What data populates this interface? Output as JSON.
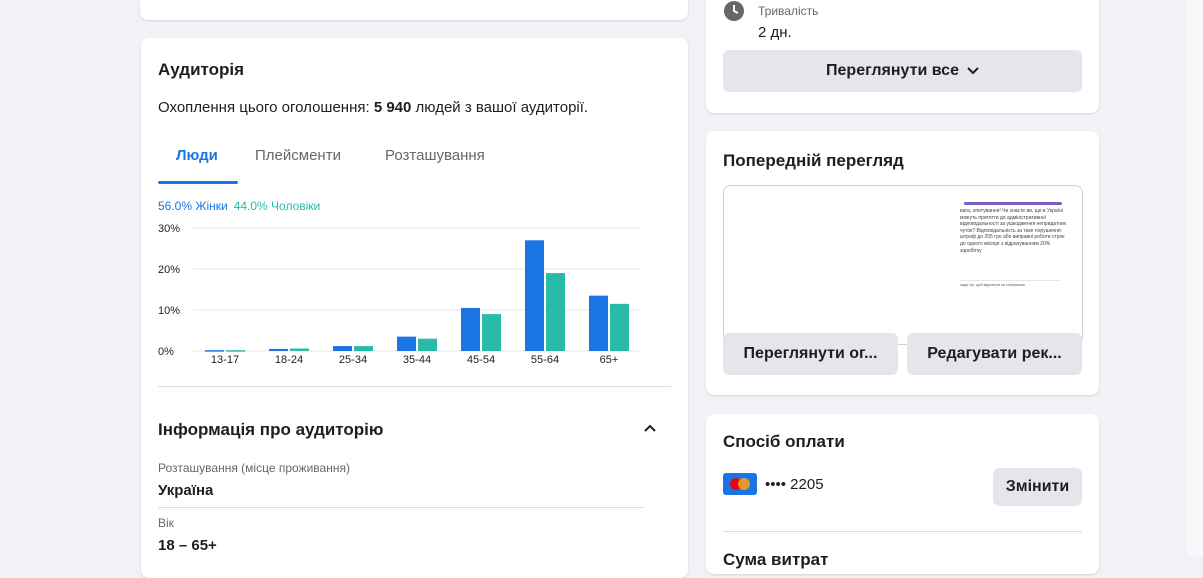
{
  "audience": {
    "title": "Аудиторія",
    "reach_prefix": "Охоплення цього оголошення: ",
    "reach_number": "5 940",
    "reach_suffix": " людей з вашої аудиторії.",
    "tabs": [
      "Люди",
      "Плейсменти",
      "Розташування"
    ],
    "active_tab": 0,
    "legend_women": "56.0% Жінки",
    "legend_men": "44.0% Чоловіки"
  },
  "chart_data": {
    "type": "bar",
    "categories": [
      "13-17",
      "18-24",
      "25-34",
      "35-44",
      "45-54",
      "55-64",
      "65+"
    ],
    "series": [
      {
        "name": "Жінки",
        "color": "#1b74e4",
        "values": [
          0.2,
          0.5,
          1.2,
          3.5,
          10.5,
          27,
          13.5
        ]
      },
      {
        "name": "Чоловіки",
        "color": "#2abba7",
        "values": [
          0.2,
          0.6,
          1.2,
          3.0,
          9.0,
          19,
          11.5
        ]
      }
    ],
    "yticks": [
      "30%",
      "20%",
      "10%",
      "0%"
    ],
    "ylim": [
      0,
      30
    ],
    "grid": true
  },
  "audience_info": {
    "title": "Інформація про аудиторію",
    "location_label": "Розташування (місце проживання)",
    "location_value": "Україна",
    "age_label": "Вік",
    "age_value": "18 – 65+"
  },
  "duration": {
    "label": "Тривалість",
    "value": "2 дн.",
    "view_all": "Переглянути все"
  },
  "preview": {
    "title": "Попередній перегляд",
    "snippet": "вага, опитування! Чи знаєте ви, що в Україні можуть притягти до адміністративної відповідальності за ушкодження непридатних чуток? Відповідальність за таке порушення: штраф до 255 грн або виправні роботи строк до одного місяця з відрахуванням 20% заробітку",
    "snippet_footer": "сюди тут, щоб відповісти на опитування",
    "view_button": "Переглянути ог...",
    "edit_button": "Редагувати рек..."
  },
  "payment": {
    "title": "Спосіб оплати",
    "card_number": "•••• 2205",
    "change_button": "Змінити",
    "next_title": "Сума витрат"
  }
}
